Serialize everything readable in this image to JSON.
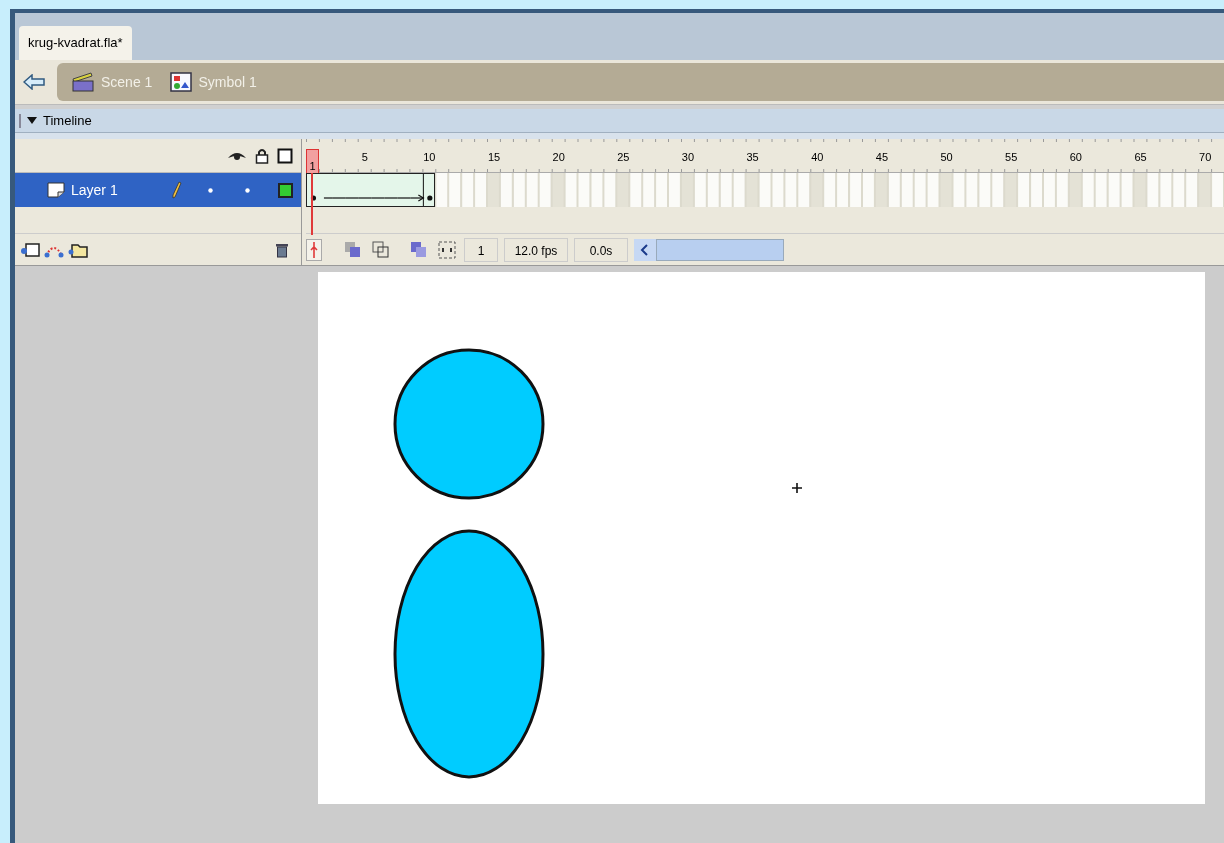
{
  "document_tab": {
    "title": "krug-kvadrat.fla*",
    "selected": true
  },
  "breadcrumbs": [
    {
      "kind": "scene",
      "label": "Scene 1"
    },
    {
      "kind": "symbol",
      "label": "Symbol 1"
    }
  ],
  "timeline": {
    "title": "Timeline",
    "expanded": true,
    "frame_ticks": [
      "1",
      "5",
      "10",
      "15",
      "20",
      "25",
      "30",
      "35",
      "40",
      "45",
      "50",
      "55",
      "60",
      "65",
      "70"
    ],
    "layers": [
      {
        "name": "Layer 1",
        "selected": true,
        "color": "#33cc33",
        "frames": [
          {
            "kind": "keyframe"
          },
          {
            "kind": "tween"
          },
          {
            "kind": "tween"
          },
          {
            "kind": "tween"
          },
          {
            "kind": "tween"
          },
          {
            "kind": "tween"
          },
          {
            "kind": "tween"
          },
          {
            "kind": "tween"
          },
          {
            "kind": "tween"
          },
          {
            "kind": "keyframe"
          }
        ]
      }
    ],
    "current_frame": "1",
    "frame_rate": "12.0 fps",
    "elapsed": "0.0s"
  }
}
